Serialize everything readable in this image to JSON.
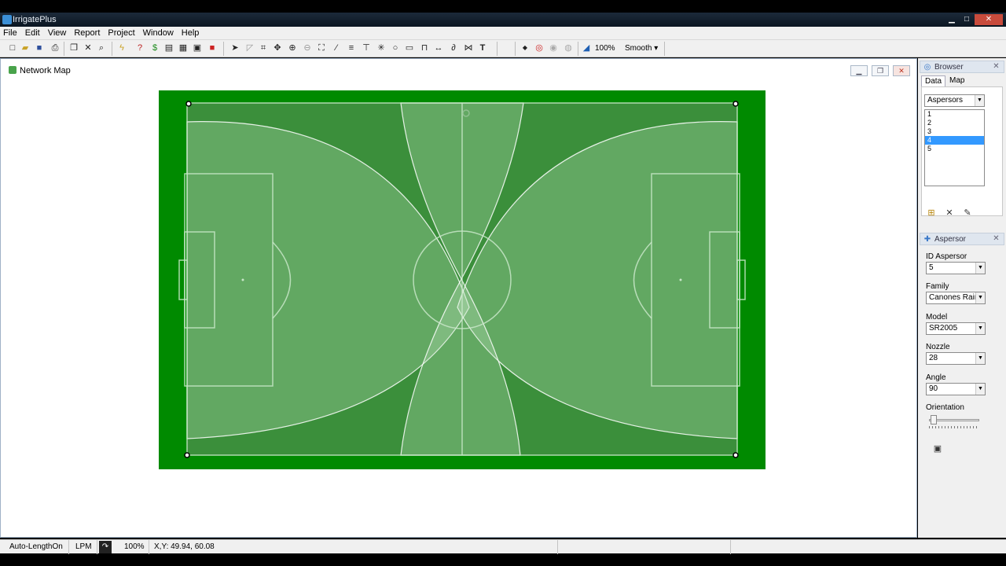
{
  "app": {
    "title": "IrrigatePlus"
  },
  "menu": [
    "File",
    "Edit",
    "View",
    "Report",
    "Project",
    "Window",
    "Help"
  ],
  "toolbar": {
    "zoom": "100%",
    "smooth": "Smooth"
  },
  "document": {
    "title": "Network Map"
  },
  "browser": {
    "title": "Browser",
    "tabs": [
      "Data",
      "Map"
    ],
    "category": "Aspersors",
    "items": [
      "1",
      "2",
      "3",
      "4",
      "5"
    ],
    "selected_index": 3
  },
  "aspersor": {
    "title": "Aspersor",
    "fields": {
      "id_label": "ID Aspersor",
      "id_value": "5",
      "family_label": "Family",
      "family_value": "Canones Rain Bird",
      "model_label": "Model",
      "model_value": "SR2005",
      "nozzle_label": "Nozzle",
      "nozzle_value": "28",
      "angle_label": "Angle",
      "angle_value": "90",
      "orientation_label": "Orientation"
    },
    "orientation_value": 0
  },
  "status": {
    "mode": "Auto-LengthOn",
    "unit": "LPM",
    "zoom": "100%",
    "coords": "X,Y: 49.94, 60.08"
  },
  "colors": {
    "grass_border": "#008a00",
    "pitch": "#3b8f3b",
    "coverage": "rgba(200,230,200,0.28)"
  }
}
